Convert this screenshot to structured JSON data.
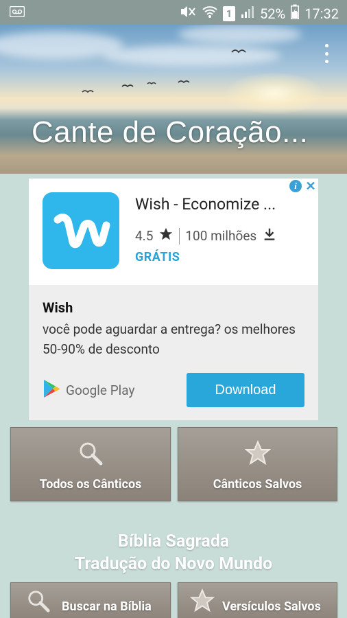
{
  "status_bar": {
    "battery": "52%",
    "time": "17:32",
    "sim": "1"
  },
  "hero": {
    "title": "Cante de Coração..."
  },
  "ad": {
    "app_title": "Wish - Economize ...",
    "rating": "4.5",
    "installs": "100 milhões",
    "price": "GRÁTIS",
    "advertiser": "Wish",
    "description": "você pode aguardar a entrega? os melhores 50-90% de desconto",
    "store_label": "Google Play",
    "cta": "Download",
    "accent": "#2aa7da"
  },
  "menu": {
    "all_songs": "Todos os Cânticos",
    "saved_songs": "Cânticos Salvos"
  },
  "bible": {
    "heading_line1": "Bíblia Sagrada",
    "heading_line2": "Tradução do Novo Mundo",
    "search": "Buscar na Bíblia",
    "saved_verses": "Versículos Salvos"
  },
  "icons": [
    "voicemail-icon",
    "mute-icon",
    "wifi-icon",
    "sim-icon",
    "signal-icon",
    "battery-icon",
    "overflow-menu-icon",
    "info-icon",
    "close-icon",
    "star-icon",
    "download-icon",
    "google-play-icon",
    "search-icon",
    "star-icon"
  ]
}
